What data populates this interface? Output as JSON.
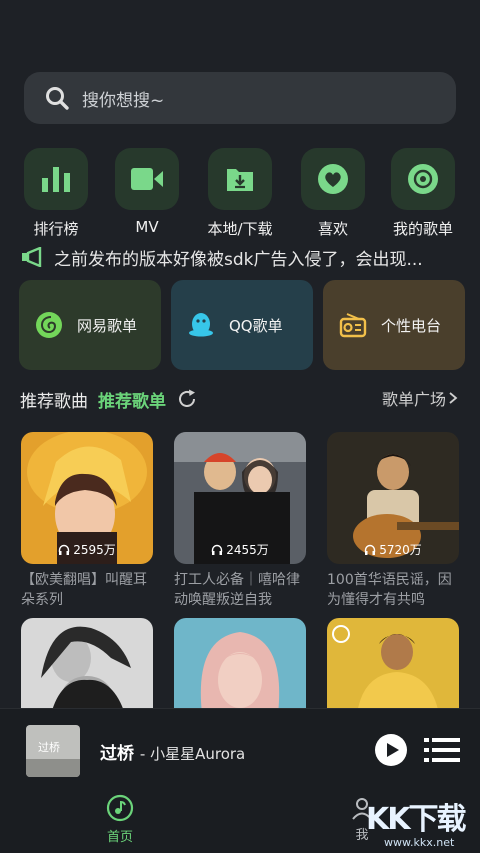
{
  "search": {
    "placeholder": "搜你想搜~"
  },
  "quick_actions": [
    {
      "label": "排行榜",
      "icon": "bar-chart-icon"
    },
    {
      "label": "MV",
      "icon": "video-camera-icon"
    },
    {
      "label": "本地/下载",
      "icon": "folder-download-icon"
    },
    {
      "label": "喜欢",
      "icon": "heart-icon"
    },
    {
      "label": "我的歌单",
      "icon": "disc-icon"
    }
  ],
  "notice": {
    "icon": "megaphone-icon",
    "text": "之前发布的版本好像被sdk广告入侵了，会出现..."
  },
  "source_cards": [
    {
      "label": "网易歌单",
      "icon": "netease-music-icon"
    },
    {
      "label": "QQ歌单",
      "icon": "qq-penguin-icon"
    },
    {
      "label": "个性电台",
      "icon": "radio-icon"
    }
  ],
  "section": {
    "tab_songs": "推荐歌曲",
    "tab_playlists": "推荐歌单",
    "more": "歌单广场",
    "active_tab": "推荐歌单"
  },
  "playlists": [
    {
      "plays": "2595万",
      "title": "【欧美翻唱】叫醒耳朵系列"
    },
    {
      "plays": "2455万",
      "title": "打工人必备｜嘻哈律动唤醒叛逆自我"
    },
    {
      "plays": "5720万",
      "title": "100首华语民谣，因为懂得才有共鸣"
    }
  ],
  "player": {
    "song": "过桥",
    "artist": "小星星Aurora",
    "art_text": "过桥"
  },
  "bottom_nav": {
    "home": "首页",
    "me": "我"
  },
  "watermark": {
    "text": "KK下载",
    "url": "www.kkx.net"
  },
  "colors": {
    "accent": "#6bd47a",
    "background": "#1e2126"
  }
}
